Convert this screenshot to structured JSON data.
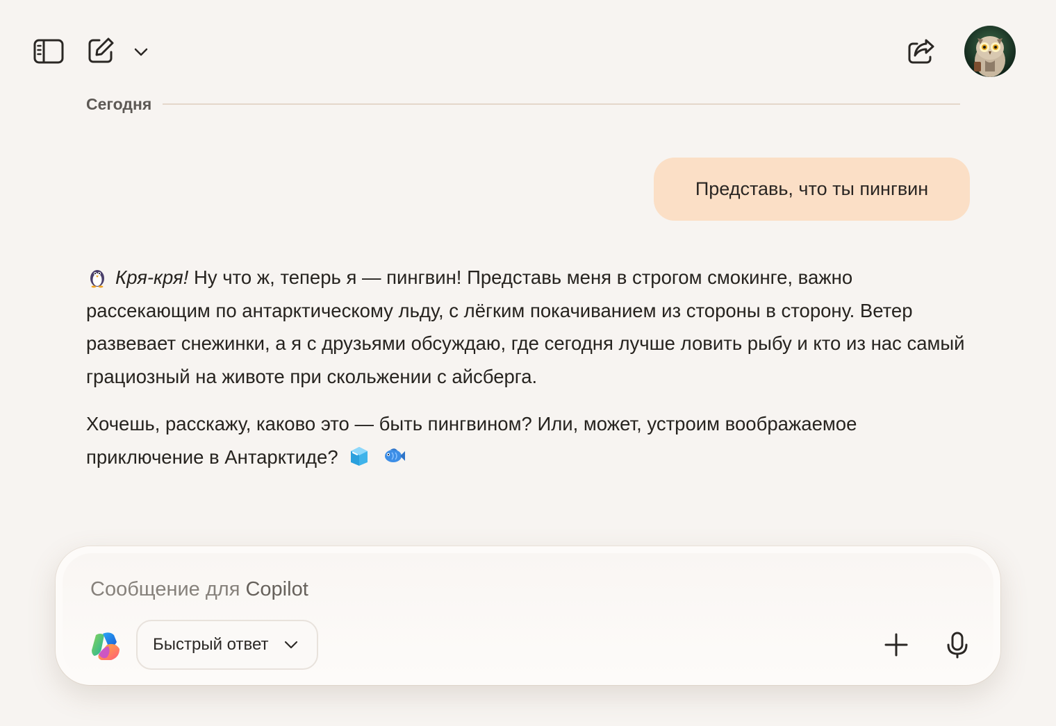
{
  "header": {
    "icons": [
      "sidebar-toggle-icon",
      "new-chat-icon",
      "chevron-down-icon",
      "share-icon",
      "owl-avatar"
    ]
  },
  "conversation": {
    "date_label": "Сегодня",
    "user_message": "Представь, что ты пингвин",
    "assistant": {
      "emoji_start": "penguin",
      "p1_italic": "Кря-кря!",
      "p1_rest": " Ну что ж, теперь я — пингвин! Представь меня в строгом смокинге, важно рассекающим по антарктическому льду, с лёгким покачиванием из стороны в сторону. Ветер развевает снежинки, а я с друзьями обсуждаю, где сегодня лучше ловить рыбу и кто из нас самый грациозный на животе при скольжении с айсберга.",
      "p2": "Хочешь, расскажу, каково это — быть пингвином? Или, может, устроим воображаемое приключение в Антарктиде?",
      "emoji_end": [
        "ice-cube",
        "fish"
      ]
    }
  },
  "composer": {
    "placeholder_prefix": "Сообщение для ",
    "placeholder_brand": "Copilot",
    "mode_label": "Быстрый ответ"
  },
  "colors": {
    "background": "#f7f4f1",
    "user_bubble": "#fbdfc6",
    "separator": "#e4d7ca"
  }
}
